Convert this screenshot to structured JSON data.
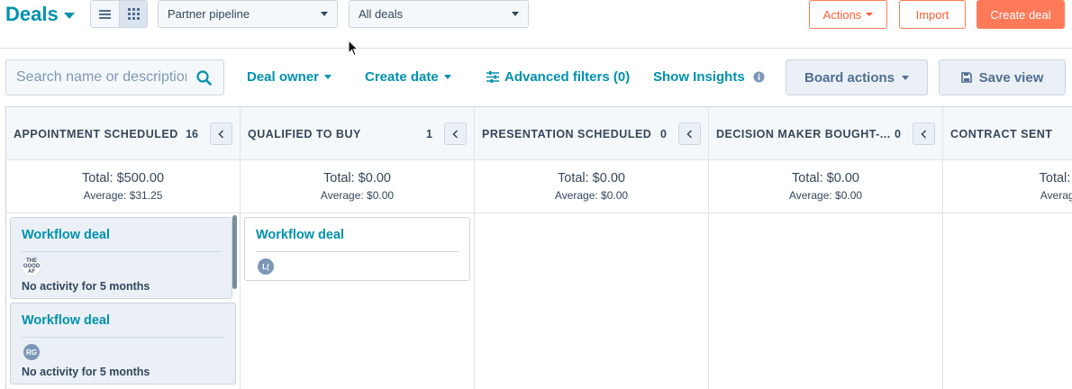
{
  "header": {
    "title": "Deals",
    "pipeline_select": "Partner pipeline",
    "view_select": "All deals",
    "actions_label": "Actions",
    "import_label": "Import",
    "create_label": "Create deal"
  },
  "filters": {
    "search_placeholder": "Search name or description",
    "deal_owner": "Deal owner",
    "create_date": "Create date",
    "advanced_filters": "Advanced filters (0)",
    "show_insights": "Show Insights",
    "board_actions": "Board actions",
    "save_view": "Save view"
  },
  "columns": [
    {
      "name": "APPOINTMENT SCHEDULED",
      "count": "16",
      "total": "Total: $500.00",
      "average": "Average: $31.25"
    },
    {
      "name": "QUALIFIED TO BUY",
      "count": "1",
      "total": "Total: $0.00",
      "average": "Average: $0.00"
    },
    {
      "name": "PRESENTATION SCHEDULED",
      "count": "0",
      "total": "Total: $0.00",
      "average": "Average: $0.00"
    },
    {
      "name": "DECISION MAKER BOUGHT-...",
      "count": "0",
      "total": "Total: $0.00",
      "average": "Average: $0.00"
    },
    {
      "name": "CONTRACT SENT",
      "count": "",
      "total": "Total: $",
      "average": "Average"
    }
  ],
  "cards": [
    {
      "title": "Workflow deal",
      "avatar": "THE GOOD AF",
      "activity": "No activity for 5 months"
    },
    {
      "title": "Workflow deal",
      "avatar": "RG",
      "activity": "No activity for 5 months"
    },
    {
      "title": "Workflow deal",
      "avatar": "L("
    }
  ],
  "colors": {
    "accent": "#0091ae",
    "brand": "#ff7a59",
    "text": "#33475b"
  }
}
